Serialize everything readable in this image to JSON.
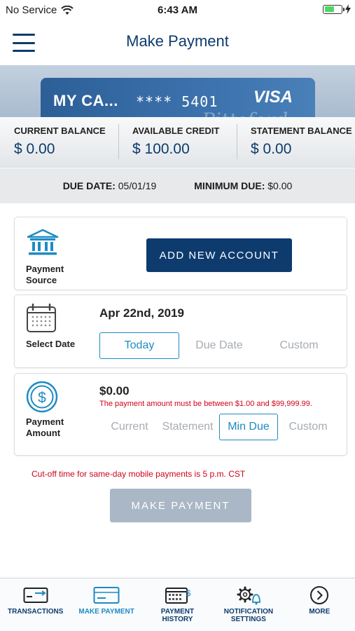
{
  "status_bar": {
    "carrier": "No Service",
    "time": "6:43 AM"
  },
  "header": {
    "title": "Make Payment"
  },
  "card": {
    "name": "MY CA...",
    "number": "**** 5401",
    "brand": "VISA",
    "script": "Pittsford"
  },
  "balances": [
    {
      "label": "CURRENT BALANCE",
      "value": "$ 0.00"
    },
    {
      "label": "AVAILABLE CREDIT",
      "value": "$ 100.00"
    },
    {
      "label": "STATEMENT BALANCE",
      "value": "$ 0.00"
    }
  ],
  "due": {
    "date_label": "DUE DATE:",
    "date_value": "05/01/19",
    "min_label": "MINIMUM DUE:",
    "min_value": "$0.00"
  },
  "source": {
    "label": "Payment Source",
    "button": "ADD NEW ACCOUNT"
  },
  "date": {
    "label": "Select Date",
    "value": "Apr 22nd, 2019",
    "options": [
      "Today",
      "Due Date",
      "Custom"
    ],
    "selected": "Today"
  },
  "amount": {
    "label": "Payment Amount",
    "value": "$0.00",
    "error": "The payment amount must be between $1.00 and $99,999.99.",
    "options": [
      "Current",
      "Statement",
      "Min Due",
      "Custom"
    ],
    "selected": "Min Due"
  },
  "cutoff_note": "Cut-off time for same-day mobile payments is 5 p.m. CST",
  "submit_button": "MAKE PAYMENT",
  "tabs": [
    {
      "label": "TRANSACTIONS",
      "icon": "card-arrow-icon",
      "active": false
    },
    {
      "label": "MAKE PAYMENT",
      "icon": "card-icon",
      "active": true
    },
    {
      "label": "PAYMENT\nHISTORY",
      "icon": "calendar-dollar-icon",
      "active": false
    },
    {
      "label": "NOTIFICATION\nSETTINGS",
      "icon": "gear-bell-icon",
      "active": false
    },
    {
      "label": "MORE",
      "icon": "chevron-right-circle-icon",
      "active": false
    }
  ],
  "colors": {
    "brand": "#0d3b6e",
    "accent": "#1e8bc3",
    "error": "#d0021b",
    "disabled": "#a9b7c6"
  }
}
